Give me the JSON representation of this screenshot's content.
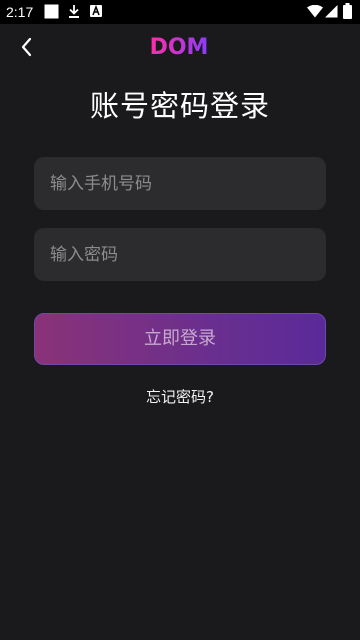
{
  "status_bar": {
    "time": "2:17",
    "icons": [
      "notification-square-icon",
      "download-icon",
      "font-a-icon",
      "wifi-icon",
      "signal-icon",
      "battery-icon"
    ]
  },
  "header": {
    "logo_text": "DOM",
    "back_icon": "chevron-left-icon"
  },
  "page": {
    "title": "账号密码登录"
  },
  "form": {
    "phone_placeholder": "输入手机号码",
    "phone_value": "",
    "password_placeholder": "输入密码",
    "password_value": "",
    "login_label": "立即登录",
    "forgot_label": "忘记密码?"
  },
  "colors": {
    "background": "#1a1a1c",
    "input_background": "#2c2c2e",
    "gradient_start": "#8a3278",
    "gradient_end": "#5a2a9a",
    "logo_start": "#ff2ea6",
    "logo_end": "#7a3cff"
  }
}
